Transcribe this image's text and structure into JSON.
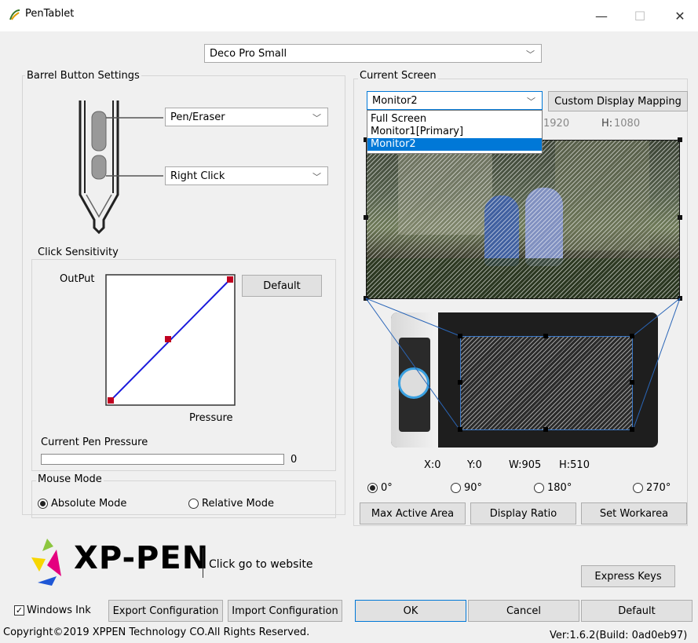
{
  "window": {
    "title": "PenTablet",
    "min": "—",
    "max": "☐",
    "close": "✕"
  },
  "device": {
    "selected": "Deco Pro Small"
  },
  "barrel": {
    "group_label": "Barrel Button Settings",
    "upper_button": "Pen/Eraser",
    "lower_button": "Right Click"
  },
  "sensitivity": {
    "group_label": "Click Sensitivity",
    "output_label": "OutPut",
    "pressure_label": "Pressure",
    "default_label": "Default"
  },
  "pen_pressure": {
    "label": "Current Pen Pressure",
    "value": "0",
    "fraction": 0
  },
  "mouse_mode": {
    "group_label": "Mouse Mode",
    "absolute": "Absolute Mode",
    "relative": "Relative Mode",
    "selected": "absolute"
  },
  "screen": {
    "group_label": "Current Screen",
    "selected": "Monitor2",
    "options": [
      "Full Screen",
      "Monitor1[Primary]",
      "Monitor2"
    ],
    "custom_mapping": "Custom Display Mapping",
    "width_partial": "1920",
    "h_label": "H:",
    "h_value": "1080"
  },
  "work_area": {
    "x": "X:0",
    "y": "Y:0",
    "w": "W:905",
    "h": "H:510"
  },
  "rotation": {
    "options": [
      "0°",
      "90°",
      "180°",
      "270°"
    ],
    "selected": "0°"
  },
  "area_buttons": {
    "max": "Max Active Area",
    "ratio": "Display Ratio",
    "set": "Set Workarea"
  },
  "brand": {
    "logo_text": "XP-PEN",
    "website": "Click go to website"
  },
  "express_keys": "Express Keys",
  "footer": {
    "windows_ink": "Windows Ink",
    "windows_ink_checked": true,
    "export": "Export Configuration",
    "import": "Import Configuration",
    "ok": "OK",
    "cancel": "Cancel",
    "default": "Default",
    "copyright": "Copyright©2019  XPPEN Technology CO.All Rights Reserved.",
    "version": "Ver:1.6.2(Build: 0ad0eb97)"
  },
  "colors": {
    "accent": "#0078d7",
    "curve": "#1a1adc",
    "point": "#c00020",
    "logo_yellow": "#f7d600",
    "logo_magenta": "#e4007f",
    "logo_blue": "#1f57d6"
  }
}
